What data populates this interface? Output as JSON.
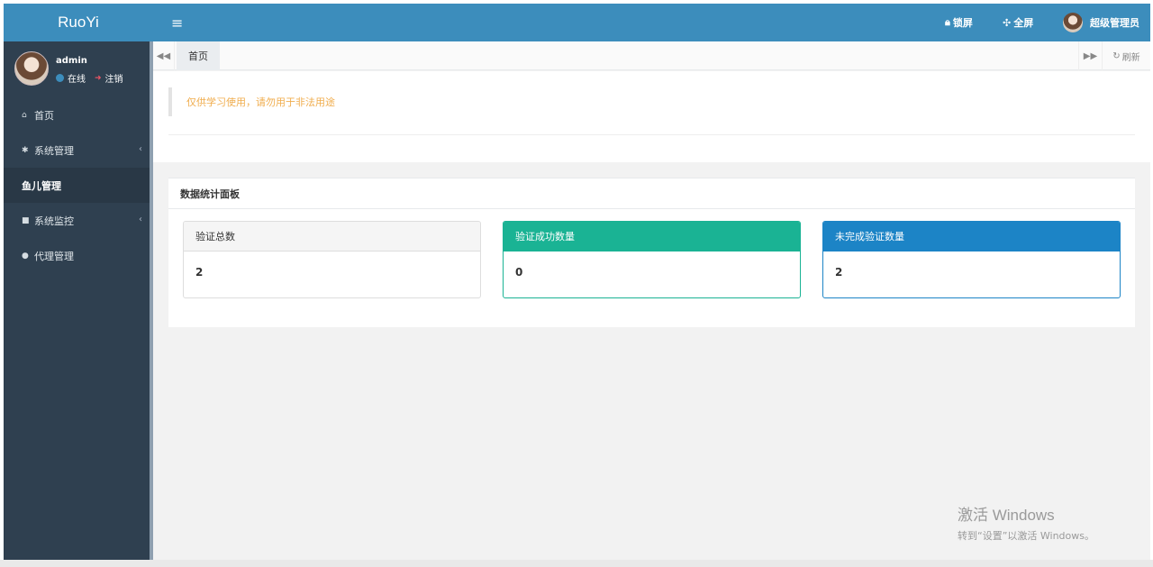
{
  "sidebar": {
    "logo": "RuoYi",
    "user": {
      "name": "admin",
      "status": "在线",
      "logout": "注销"
    },
    "menu": [
      {
        "icon": "home-icon",
        "label": "首页",
        "active": false,
        "submenu": false
      },
      {
        "icon": "gear-icon",
        "label": "系统管理",
        "active": false,
        "submenu": true
      },
      {
        "icon": "",
        "label": "鱼儿管理",
        "active": true,
        "submenu": false
      },
      {
        "icon": "video-camera-icon",
        "label": "系统监控",
        "active": false,
        "submenu": true
      },
      {
        "icon": "user-icon",
        "label": "代理管理",
        "active": false,
        "submenu": false
      }
    ]
  },
  "header": {
    "lock_label": "锁屏",
    "fullscreen_label": "全屏",
    "user_label": "超级管理员"
  },
  "tabs": {
    "items": [
      {
        "label": "首页",
        "active": true
      }
    ],
    "refresh_label": "刷新"
  },
  "notice": {
    "text": "仅供学习使用，请勿用于非法用途"
  },
  "dashboard": {
    "title": "数据统计面板",
    "stats": [
      {
        "label": "验证总数",
        "value": "2",
        "color": "#f5f5f5"
      },
      {
        "label": "验证成功数量",
        "value": "0",
        "color": "#1ab394"
      },
      {
        "label": "未完成验证数量",
        "value": "2",
        "color": "#1c84c6"
      }
    ]
  },
  "watermark": {
    "line1": "激活 Windows",
    "line2": "转到“设置”以激活 Windows。"
  },
  "colors": {
    "header": "#3c8dbc",
    "sidebar": "#2f4050",
    "sidebar_active": "#293846",
    "notice_text": "#f0ad4e"
  }
}
